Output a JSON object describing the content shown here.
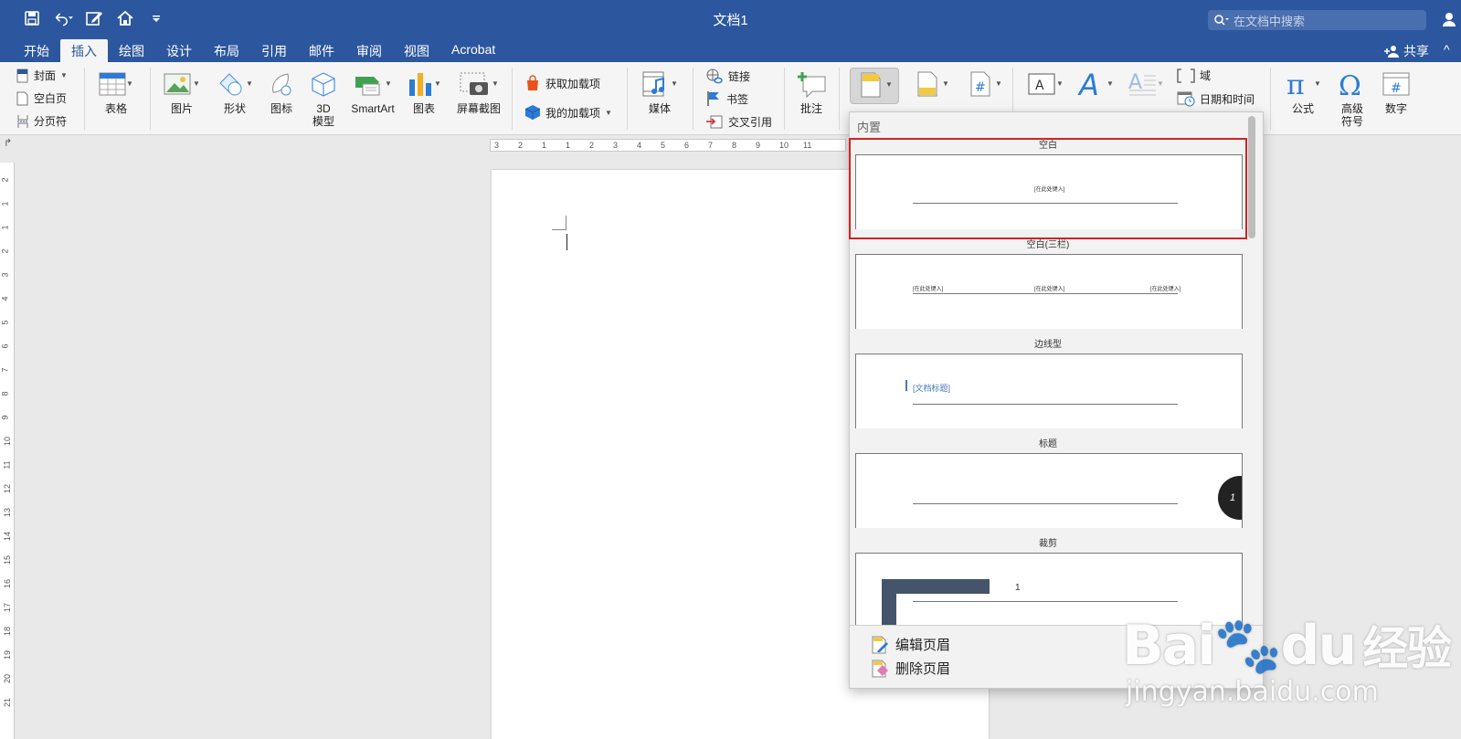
{
  "window": {
    "title": "文档1"
  },
  "search": {
    "placeholder": "在文档中搜索"
  },
  "tabs": [
    {
      "label": "开始"
    },
    {
      "label": "插入"
    },
    {
      "label": "绘图"
    },
    {
      "label": "设计"
    },
    {
      "label": "布局"
    },
    {
      "label": "引用"
    },
    {
      "label": "邮件"
    },
    {
      "label": "审阅"
    },
    {
      "label": "视图"
    },
    {
      "label": "Acrobat"
    }
  ],
  "share": {
    "label": "共享"
  },
  "ribbon": {
    "pages": {
      "cover": "封面",
      "blank_page": "空白页",
      "page_break": "分页符"
    },
    "table": "表格",
    "pictures": "图片",
    "shapes": "形状",
    "icons": "图标",
    "model3d": {
      "l1": "3D",
      "l2": "模型"
    },
    "smartart": "SmartArt",
    "chart": "图表",
    "screenshot": "屏幕截图",
    "get_addins": "获取加载项",
    "my_addins": "我的加载项",
    "media": "媒体",
    "link": "链接",
    "bookmark": "书签",
    "cross_ref": "交叉引用",
    "comment": "批注",
    "field": "域",
    "datetime": "日期和时间",
    "equation": "公式",
    "symbol": {
      "l1": "高级",
      "l2": "符号"
    },
    "number": "数字"
  },
  "ruler": {
    "marks": [
      "3",
      "2",
      "1",
      "1",
      "2",
      "3",
      "4",
      "5",
      "6",
      "7",
      "8",
      "9",
      "10",
      "11"
    ]
  },
  "vruler": {
    "marks": [
      "2",
      "1",
      "1",
      "2",
      "3",
      "4",
      "5",
      "6",
      "7",
      "8",
      "9",
      "10",
      "11",
      "12",
      "13",
      "14",
      "15",
      "16",
      "17",
      "18",
      "19",
      "20",
      "21"
    ]
  },
  "gallery": {
    "section": "内置",
    "items": [
      {
        "label": "空白",
        "ph": "[在此处键入]"
      },
      {
        "label": "空白(三栏)",
        "ph1": "[在此处键入]",
        "ph2": "[在此处键入]",
        "ph3": "[在此处键入]"
      },
      {
        "label": "边线型",
        "ph": "[文档标题]"
      },
      {
        "label": "标题",
        "num": "1"
      },
      {
        "label": "裁剪",
        "num": "1"
      }
    ],
    "edit_header": "编辑页眉",
    "remove_header": "删除页眉"
  },
  "watermark": {
    "brand": "Bai",
    "brand2": "du",
    "cn": "经验",
    "url": "jingyan.baidu.com"
  },
  "colors": {
    "accent": "#2c579e",
    "selection": "#d42222"
  }
}
